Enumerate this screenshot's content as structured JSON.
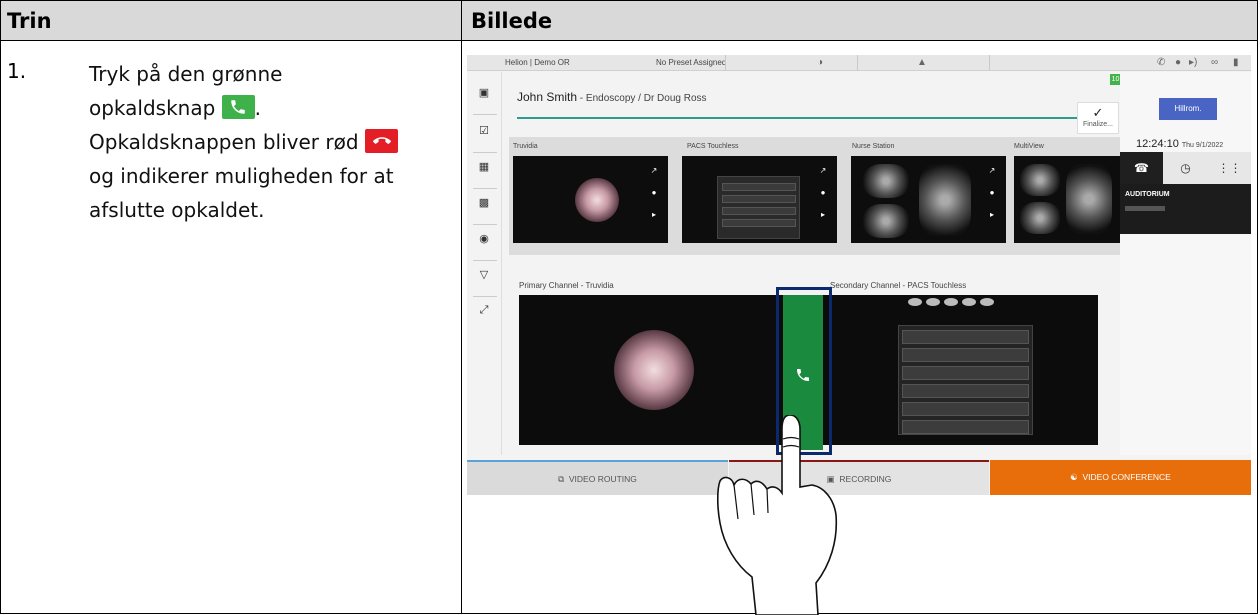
{
  "table": {
    "header_step": "Trin",
    "header_image": "Billede",
    "step_number": "1.",
    "line1": "Tryk på den grønne",
    "line2a": "opkaldsknap",
    "line2b": ".",
    "line3a": "Opkaldsknappen bliver rød",
    "line4": "og indikerer muligheden for at",
    "line5": "afslutte opkaldet."
  },
  "ui": {
    "location": "Helion | Demo OR",
    "preset": "No Preset Assigned",
    "patient_name": "John Smith",
    "patient_sub": " - Endoscopy / Dr Doug Ross",
    "finalize_label": "Finalize...",
    "finalize_badge": "10",
    "brand": "Hillrom.",
    "time": "12:24:10",
    "date": "Thu 9/1/2022",
    "auditorium_label": "AUDITORIUM",
    "tiles": [
      "Truvidia",
      "PACS Touchless",
      "Nurse Station",
      "MultiView"
    ],
    "primary_channel": "Primary Channel - Truvidia",
    "secondary_channel_a": "Se",
    "secondary_channel_b": "condary Channel - PACS Touchless",
    "tab_routing": "VIDEO ROUTING",
    "tab_recording": "RECORDING",
    "tab_conference": "VIDEO CONFERENCE"
  },
  "colors": {
    "call_green": "#3fb14a",
    "call_red": "#e41e26",
    "conference_orange": "#e86e0b",
    "brand_blue": "#4a64c4"
  }
}
